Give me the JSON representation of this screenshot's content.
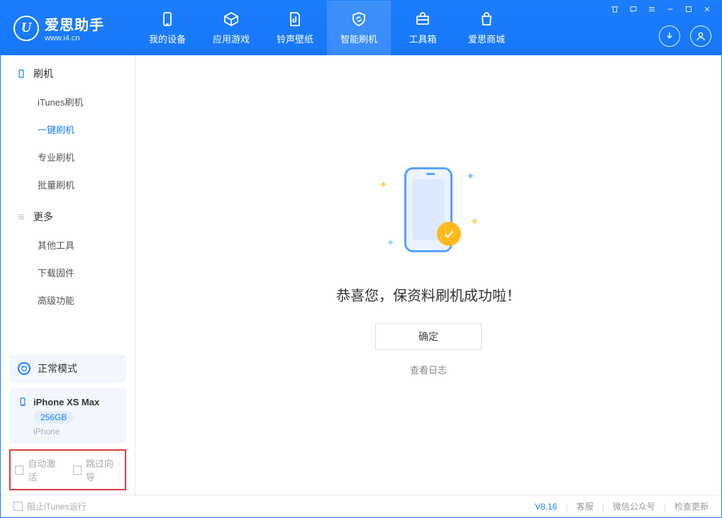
{
  "app": {
    "title": "爱思助手",
    "sub": "www.i4.cn"
  },
  "nav": {
    "device": "我的设备",
    "apps": "应用游戏",
    "ring": "铃声壁纸",
    "flash": "智能刷机",
    "tools": "工具箱",
    "store": "爱思商城"
  },
  "sidebar": {
    "flash_head": "刷机",
    "flash_items": {
      "itunes": "iTunes刷机",
      "onekey": "一键刷机",
      "pro": "专业刷机",
      "batch": "批量刷机"
    },
    "more_head": "更多",
    "more_items": {
      "other": "其他工具",
      "firmware": "下载固件",
      "advanced": "高级功能"
    },
    "status_mode": "正常模式",
    "device_name": "iPhone XS Max",
    "storage": "256GB",
    "device_type": "iPhone",
    "opt_auto_activate": "自动激活",
    "opt_skip_guide": "跳过向导"
  },
  "main": {
    "success_text": "恭喜您，保资料刷机成功啦！",
    "ok": "确定",
    "view_log": "查看日志"
  },
  "footer": {
    "block_itunes": "阻止iTunes运行",
    "version": "V8.16",
    "support": "客服",
    "wechat": "微信公众号",
    "update": "检查更新"
  }
}
